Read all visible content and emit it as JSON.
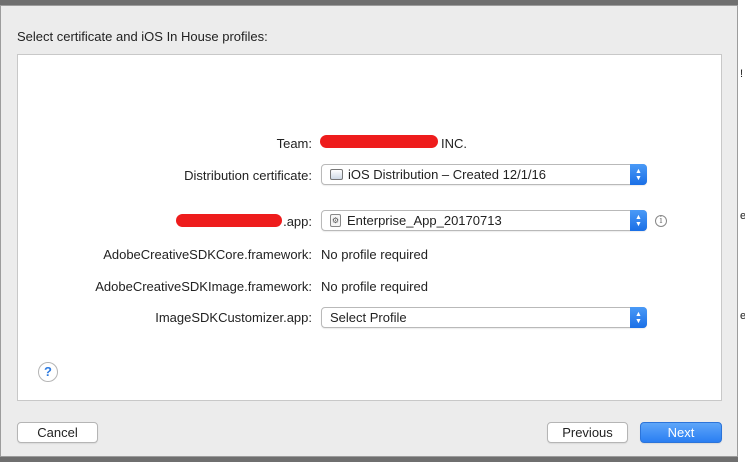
{
  "dialog": {
    "heading": "Select certificate and iOS In House profiles:"
  },
  "rows": {
    "team": {
      "label": "Team:",
      "value_suffix": "INC."
    },
    "certificate": {
      "label": "Distribution certificate:",
      "selected": "iOS Distribution – Created 12/1/16"
    },
    "app": {
      "label_suffix": ".app:",
      "selected": "Enterprise_App_20170713"
    },
    "sdk_core": {
      "label": "AdobeCreativeSDKCore.framework:",
      "value": "No profile required"
    },
    "sdk_image": {
      "label": "AdobeCreativeSDKImage.framework:",
      "value": "No profile required"
    },
    "customizer": {
      "label": "ImageSDKCustomizer.app:",
      "selected": "Select Profile"
    }
  },
  "help": {
    "glyph": "?"
  },
  "info": {
    "glyph": "i"
  },
  "buttons": {
    "cancel": "Cancel",
    "previous": "Previous",
    "next": "Next"
  },
  "colors": {
    "accent": "#2a7ef2",
    "redaction": "#ee1c1c"
  }
}
